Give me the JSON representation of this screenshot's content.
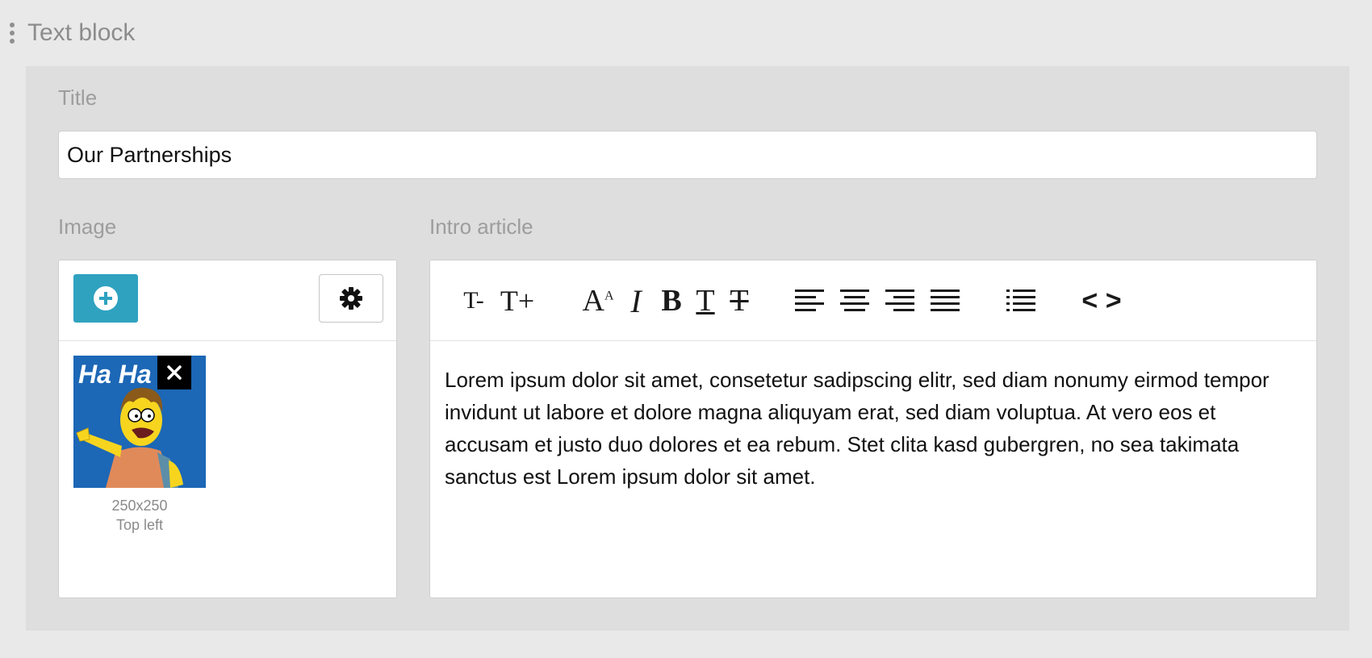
{
  "block": {
    "title": "Text block"
  },
  "fields": {
    "title_label": "Title",
    "title_value": "Our Partnerships",
    "image_label": "Image",
    "intro_label": "Intro article"
  },
  "image": {
    "add_icon": "plus-circle-icon",
    "settings_icon": "gear-icon",
    "thumb_text": "Ha Ha",
    "dimensions": "250x250",
    "position": "Top left"
  },
  "toolbar": {
    "font_decrease": "T-",
    "font_increase": "T+",
    "superscript": "A",
    "italic": "I",
    "bold": "B",
    "underline": "T",
    "strikethrough": "T",
    "source": "< >"
  },
  "intro": {
    "text": "Lorem ipsum dolor sit amet, consetetur sadipscing elitr, sed diam nonumy eirmod tempor invidunt ut labore et dolore magna aliquyam erat, sed diam voluptua. At vero eos et accusam et justo duo dolores et ea rebum. Stet clita kasd gubergren, no sea takimata sanctus est Lorem ipsum dolor sit amet."
  },
  "colors": {
    "accent": "#2fa2c0",
    "panel": "#dedede",
    "background": "#e9e9e9"
  }
}
